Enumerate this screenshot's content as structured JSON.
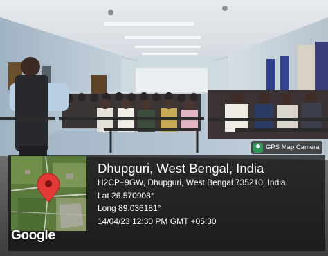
{
  "badge": {
    "icon": "gps-map-camera-icon",
    "text": "GPS Map Camera"
  },
  "location": {
    "title": "Dhupguri, West Bengal, India",
    "address": "H2CP+9GW, Dhupguri, West Bengal 735210, India",
    "lat": "Lat 26.570908°",
    "long": "Long 89.036181°",
    "datetime": "14/04/23 12:30 PM GMT +05:30"
  },
  "map": {
    "pin_icon": "map-pin-icon",
    "attribution": "Google"
  },
  "colors": {
    "pin": "#e53935",
    "overlay": "#1a1a1a"
  }
}
